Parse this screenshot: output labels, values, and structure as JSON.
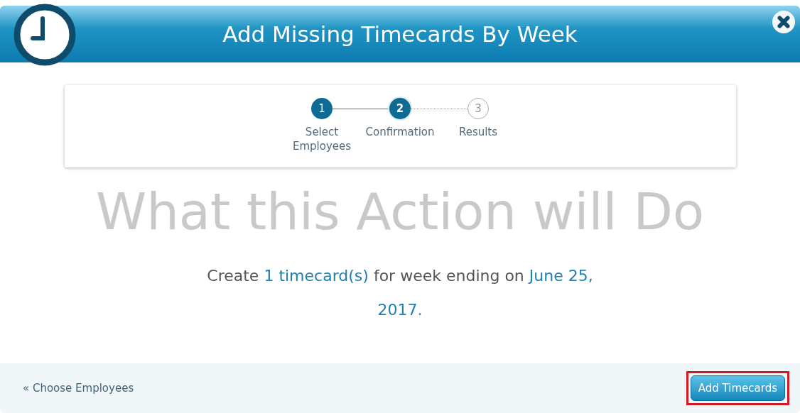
{
  "dialog": {
    "title": "Add Missing Timecards By Week"
  },
  "steps": [
    {
      "number": "1",
      "label": "Select Employees",
      "completed": true,
      "selected": false
    },
    {
      "number": "2",
      "label": "Confirmation",
      "completed": false,
      "selected": true
    },
    {
      "number": "3",
      "label": "Results",
      "completed": false,
      "selected": false
    }
  ],
  "heading": "What this Action will Do",
  "summary": [
    {
      "kind": "text",
      "text": "Create "
    },
    {
      "kind": "value",
      "text": "1 timecard(s)"
    },
    {
      "kind": "text",
      "text": " for week ending on "
    },
    {
      "kind": "value",
      "text": "June 25, 2017."
    }
  ],
  "footer": {
    "back_link": "« Choose Employees",
    "primary_button": {
      "label": "Add Timecards",
      "highlighted": true
    }
  }
}
